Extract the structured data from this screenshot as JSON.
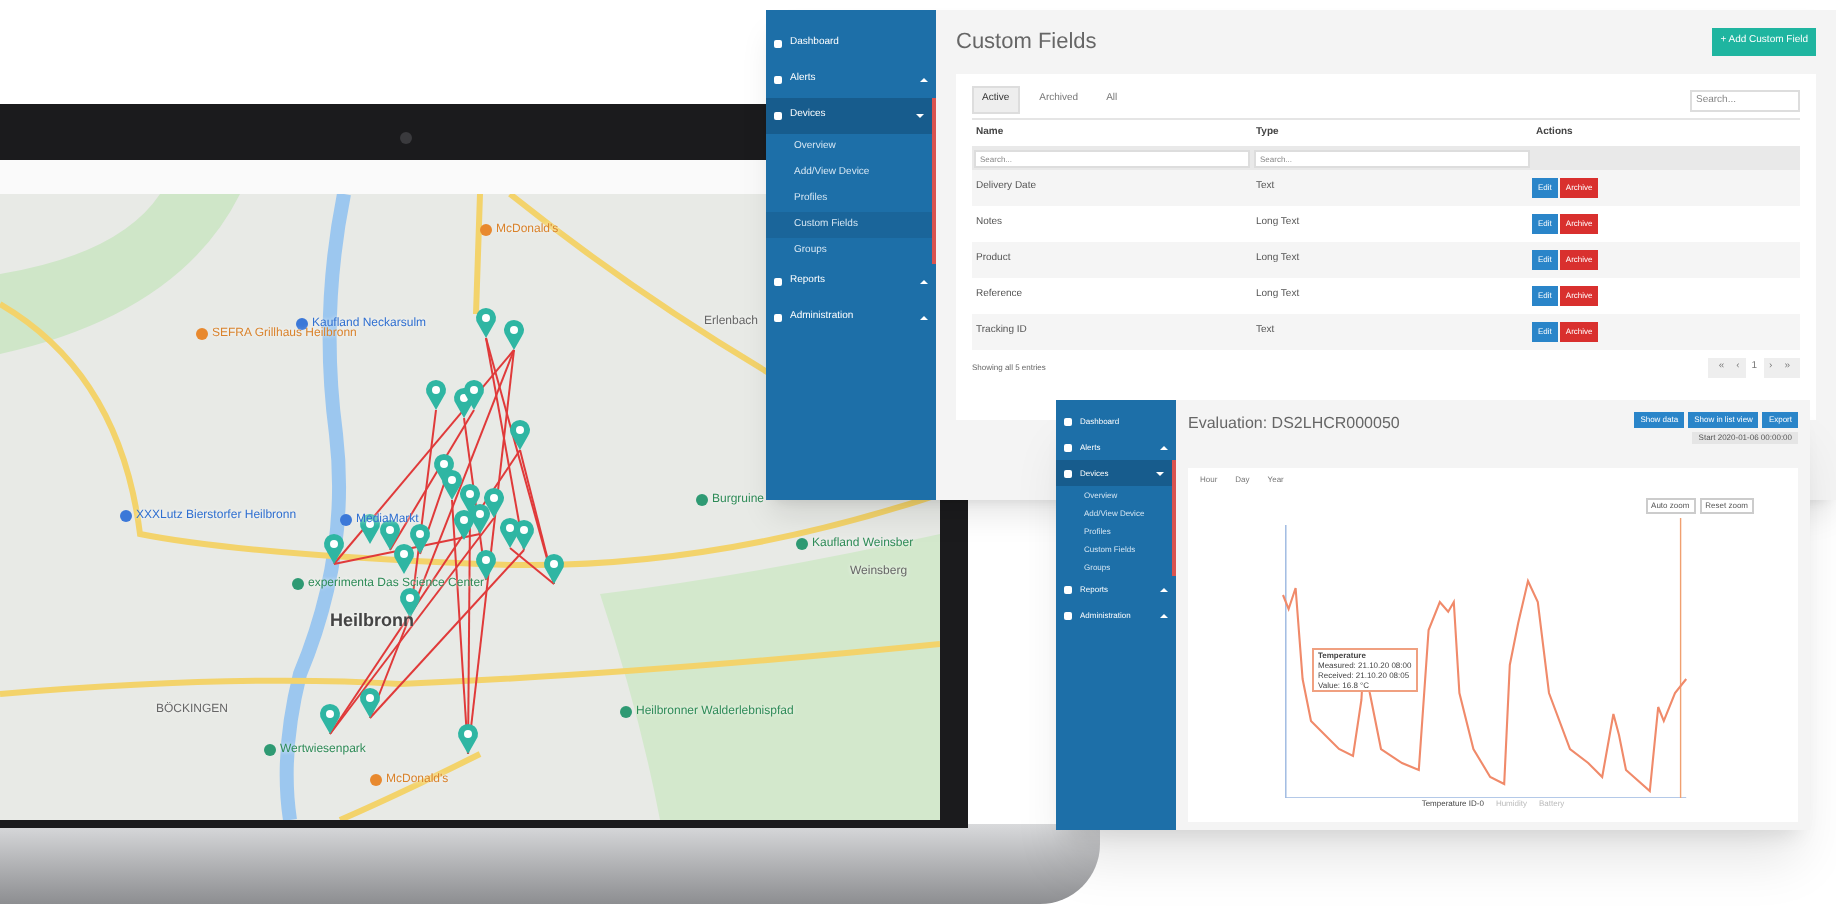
{
  "laptop": {
    "map": {
      "labels": [
        {
          "text": "McDonald's",
          "kind": "food"
        },
        {
          "text": "Kaufland Neckarsulm",
          "kind": "shop"
        },
        {
          "text": "SEFRA Grillhaus Heilbronn",
          "kind": "food"
        },
        {
          "text": "Erlenbach",
          "kind": "place"
        },
        {
          "text": "XXXLutz Bierstorfer Heilbronn",
          "kind": "shop"
        },
        {
          "text": "MediaMarkt",
          "kind": "shop"
        },
        {
          "text": "Burgruine",
          "kind": "park"
        },
        {
          "text": "Kaufland Weinsber",
          "kind": "park"
        },
        {
          "text": "Weinsberg",
          "kind": "place"
        },
        {
          "text": "experimenta Das Science Center",
          "kind": "park"
        },
        {
          "text": "Heilbronn",
          "kind": "city"
        },
        {
          "text": "BÖCKINGEN",
          "kind": "place"
        },
        {
          "text": "Heilbronner Walderlebnispfad",
          "kind": "park"
        },
        {
          "text": "Wertwiesenpark",
          "kind": "park"
        },
        {
          "text": "McDonald's",
          "kind": "food"
        }
      ]
    }
  },
  "custom_fields_window": {
    "sidebar": [
      {
        "label": "Dashboard",
        "selected": false
      },
      {
        "label": "Alerts",
        "selected": false,
        "expanded": false
      },
      {
        "label": "Devices",
        "selected": true,
        "expanded": true,
        "children": [
          {
            "label": "Overview",
            "selected": false
          },
          {
            "label": "Add/View Device",
            "selected": false
          },
          {
            "label": "Profiles",
            "selected": false
          },
          {
            "label": "Custom Fields",
            "selected": true
          },
          {
            "label": "Groups",
            "selected": false
          }
        ]
      },
      {
        "label": "Reports",
        "selected": false,
        "expanded": false
      },
      {
        "label": "Administration",
        "selected": false,
        "expanded": false
      }
    ],
    "title": "Custom Fields",
    "add_button": "+ Add Custom Field",
    "tabs": [
      {
        "label": "Active",
        "selected": true
      },
      {
        "label": "Archived",
        "selected": false
      },
      {
        "label": "All",
        "selected": false
      }
    ],
    "search": {
      "placeholder": "Search..."
    },
    "columns": [
      "Name",
      "Type",
      "Actions"
    ],
    "filters": [
      {
        "placeholder": "Search..."
      },
      {
        "placeholder": "Search..."
      }
    ],
    "rows": [
      {
        "name": "Delivery Date",
        "type": "Text",
        "actions": [
          "Edit",
          "Archive"
        ]
      },
      {
        "name": "Notes",
        "type": "Long Text",
        "actions": [
          "Edit",
          "Archive"
        ]
      },
      {
        "name": "Product",
        "type": "Long Text",
        "actions": [
          "Edit",
          "Archive"
        ]
      },
      {
        "name": "Reference",
        "type": "Long Text",
        "actions": [
          "Edit",
          "Archive"
        ]
      },
      {
        "name": "Tracking ID",
        "type": "Text",
        "actions": [
          "Edit",
          "Archive"
        ]
      }
    ],
    "footer": "Showing all 5 entries",
    "pagination": [
      "«",
      "‹",
      "1",
      "›",
      "»"
    ]
  },
  "evaluation_window": {
    "sidebar": [
      {
        "label": "Dashboard",
        "selected": false
      },
      {
        "label": "Alerts",
        "selected": false,
        "expanded": false
      },
      {
        "label": "Devices",
        "selected": true,
        "expanded": true,
        "children": [
          {
            "label": "Overview",
            "selected": false
          },
          {
            "label": "Add/View Device",
            "selected": false
          },
          {
            "label": "Profiles",
            "selected": false
          },
          {
            "label": "Custom Fields",
            "selected": false
          },
          {
            "label": "Groups",
            "selected": false
          }
        ]
      },
      {
        "label": "Reports",
        "selected": false,
        "expanded": false
      },
      {
        "label": "Administration",
        "selected": false,
        "expanded": false
      }
    ],
    "title": "Evaluation: DS2LHCR000050",
    "buttons": [
      "Show data",
      "Show in list view",
      "Export"
    ],
    "range": "Start 2020-01-06 00:00:00",
    "tabs": [
      {
        "label": "Hour",
        "selected": false
      },
      {
        "label": "Day",
        "selected": false
      },
      {
        "label": "Year",
        "selected": false
      }
    ],
    "zoom_buttons": [
      "Auto zoom",
      "Reset zoom"
    ],
    "tooltip": [
      "Temperature",
      "Measured: 21.10.20 08:00",
      "Received: 21.10.20 08:05",
      "Value: 16.8 °C"
    ],
    "legend": [
      "Temperature ID-0",
      "Humidity",
      "Battery"
    ]
  }
}
